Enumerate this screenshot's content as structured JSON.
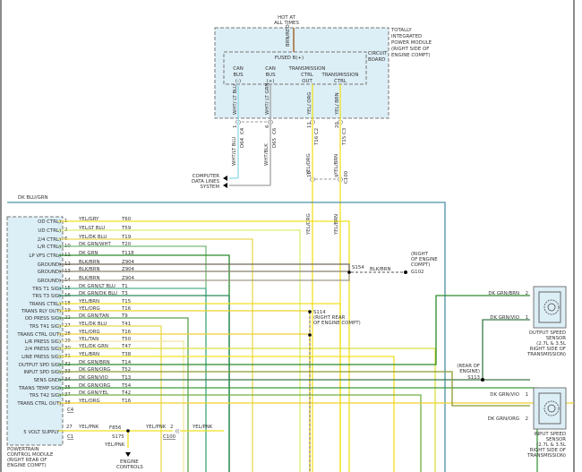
{
  "tipm": {
    "hot_label": [
      "HOT AT",
      "ALL TIMES"
    ],
    "feed_wire": "BRN/RED",
    "module_label": [
      "TOTALLY",
      "INTEGRATED",
      "POWER MODULE",
      "(RIGHT SIDE OF",
      "ENGINE COMPT)"
    ],
    "board_label": [
      "CIRCUIT",
      "BOARD"
    ],
    "fused": "FUSED B(+)",
    "outputs": [
      {
        "name": [
          "CAN",
          "BUS",
          "(-)"
        ],
        "int_wire": "WHT/ LT BLU",
        "pin": "1",
        "wire": "WHT/LT BLU",
        "circuit": "D64",
        "conn": "C4",
        "color": "#8fd8e8"
      },
      {
        "name": [
          "CAN",
          "BUS",
          "(+)"
        ],
        "int_wire": "WHT/ LT GRN",
        "pin": "6",
        "wire": "WHT/BLK",
        "circuit": "D65",
        "conn": "C6",
        "color": "#a0a0a0"
      },
      {
        "name": [
          "TRANSMISSION",
          "CTRL",
          "OUT"
        ],
        "int_wire": "YEL/ ORG",
        "pin": "11",
        "wire": "YEL/ORG",
        "circuit": "T16",
        "conn": "C2",
        "color": "#f0e020"
      },
      {
        "name": [
          "TRANSMISSION",
          "CTRL"
        ],
        "int_wire": "YEL/ BRN",
        "pin": "20",
        "wire": "YEL/BRN",
        "circuit": "T15",
        "conn": "C3",
        "color": "#f0e020"
      }
    ],
    "c100_pins": [
      "10",
      "9"
    ],
    "c100": "C100"
  },
  "computer_data_lines": [
    "COMPUTER",
    "DATA LINES",
    "SYSTEM"
  ],
  "dk_blu_grn": "DK BLU/GRN",
  "pcm": {
    "label": [
      "POWERTRAIN",
      "CONTROL MODULE",
      "(RIGHT REAR OF",
      "ENGINE COMPT)"
    ],
    "pins": [
      {
        "pin": "1",
        "func": "OD CTRL",
        "wire": "YEL/GRY",
        "circuit": "T60",
        "color": "#f0e020"
      },
      {
        "pin": "2",
        "func": "UD CTRL",
        "wire": "YEL/LT BLU",
        "circuit": "T59",
        "color": "#d8f070"
      },
      {
        "pin": "6",
        "func": "2/4 CTRL",
        "wire": "YEL/DK BLU",
        "circuit": "T19",
        "color": "#e8d850"
      },
      {
        "pin": "10",
        "func": "L/R CTRL",
        "wire": "DK GRN/WHT",
        "circuit": "T20",
        "color": "#78b878"
      },
      {
        "pin": "11",
        "func": "LP VFS CTRL",
        "wire": "DK GRN",
        "circuit": "T118",
        "color": "#2a8a2a"
      },
      {
        "pin": "12",
        "func": "GROUND",
        "wire": "BLK/BRN",
        "circuit": "Z904",
        "color": "#706858"
      },
      {
        "pin": "13",
        "func": "GROUND",
        "wire": "BLK/BRN",
        "circuit": "Z904",
        "color": "#8a8070"
      },
      {
        "pin": "14",
        "func": "GROUND",
        "wire": "BLK/BRN",
        "circuit": "Z904",
        "color": "#a09888"
      },
      {
        "pin": "15",
        "func": "TRS T1 SIG",
        "wire": "DK GRN/LT BLU",
        "circuit": "T1",
        "color": "#50b090"
      },
      {
        "pin": "16",
        "func": "TRS T3 SIG",
        "wire": "DK GRN/DK BLU",
        "circuit": "T3",
        "color": "#2a8a5a"
      },
      {
        "pin": "18",
        "func": "TRANS CTRL",
        "wire": "YEL/BRN",
        "circuit": "T15",
        "color": "#f0e020"
      },
      {
        "pin": "19",
        "func": "TRANS RLY OUT",
        "wire": "YEL/ORG",
        "circuit": "T16",
        "color": "#f0d030"
      },
      {
        "pin": "22",
        "func": "OD PRESS SIG",
        "wire": "DK GRN/TAN",
        "circuit": "T9",
        "color": "#5aa050"
      },
      {
        "pin": "27",
        "func": "TRS T41 SIG",
        "wire": "YEL/DK BLU",
        "circuit": "T41",
        "color": "#e8d850"
      },
      {
        "pin": "28",
        "func": "TRANS CTRL OUT",
        "wire": "YEL/ORG",
        "circuit": "T16",
        "color": "#f0d030"
      },
      {
        "pin": "29",
        "func": "L/R PRESS SIG",
        "wire": "YEL/TAN",
        "circuit": "T50",
        "color": "#f0e8a0"
      },
      {
        "pin": "30",
        "func": "2/4 PRESS SIG",
        "wire": "YEL/DK GRN",
        "circuit": "T47",
        "color": "#d8e040"
      },
      {
        "pin": "31",
        "func": "LINE PRESS SIG",
        "wire": "YEL/BRN",
        "circuit": "T38",
        "color": "#f0e020"
      },
      {
        "pin": "32",
        "func": "OUTPUT SPD SIG",
        "wire": "DK GRN/BRN",
        "circuit": "T14",
        "color": "#2a8a2a"
      },
      {
        "pin": "33",
        "func": "INPUT SPD SIG",
        "wire": "DK GRN/ORG",
        "circuit": "T52",
        "color": "#3a9a3a"
      },
      {
        "pin": "34",
        "func": "SENS GND",
        "wire": "DK GRN/VIO",
        "circuit": "T13",
        "color": "#3a7a4a"
      },
      {
        "pin": "35",
        "func": "TRANS TEMP SIG",
        "wire": "DK GRN/ORG",
        "circuit": "T54",
        "color": "#3a9a3a"
      },
      {
        "pin": "37",
        "func": "TRS T42 SIG",
        "wire": "DK GRN/YEL",
        "circuit": "T42",
        "color": "#70b040"
      },
      {
        "pin": "38",
        "func": "TRANS CTRL OUT",
        "wire": "YEL/ORG",
        "circuit": "T16",
        "color": "#f0d030"
      }
    ],
    "conn_c4": "C4",
    "supply": {
      "pin": "27",
      "func": "5 VOLT SUPPLY",
      "wire": "YEL/PNK",
      "circuit": "F856",
      "conn": "C1",
      "color": "#f0e020"
    }
  },
  "splices": {
    "s154": "S154",
    "s154_wire": "BLK/BRN",
    "g102": [
      "(RIGHT",
      "OF ENGINE",
      "COMPT)",
      "G102"
    ],
    "s114": [
      "S114",
      "(RIGHT REAR",
      "OF ENGINE COMPT)"
    ],
    "s113": [
      "(REAR OF",
      "ENGINE)",
      "S113"
    ],
    "s175": "S175",
    "s175_wire": "YEL/PNK",
    "engine_controls": [
      "ENGINE",
      "CONTROLS"
    ],
    "c100_wire": "YEL/PNK",
    "c100_pin": "2",
    "c100": "C100",
    "c100_out_wire": "YEL/PNK"
  },
  "sensors": [
    {
      "name": [
        "OUTPUT SPEED",
        "SENSOR",
        "(2.7L & 3.5L",
        "RIGHT SIDE OF",
        "TRANSMISSION)"
      ],
      "pins": [
        {
          "pin": "2",
          "wire": "DK GRN/BRN"
        },
        {
          "pin": "1",
          "wire": "DK GRN/VIO"
        }
      ]
    },
    {
      "name": [
        "INPUT SPEED",
        "SENSOR",
        "(2.7L & 3.5L",
        "RIGHT SIDE OF",
        "TRANSMISSION)"
      ],
      "pins": [
        {
          "pin": "1",
          "wire": "DK GRN/VIO"
        },
        {
          "pin": "2",
          "wire": "DK GRN/ORG"
        }
      ]
    }
  ]
}
